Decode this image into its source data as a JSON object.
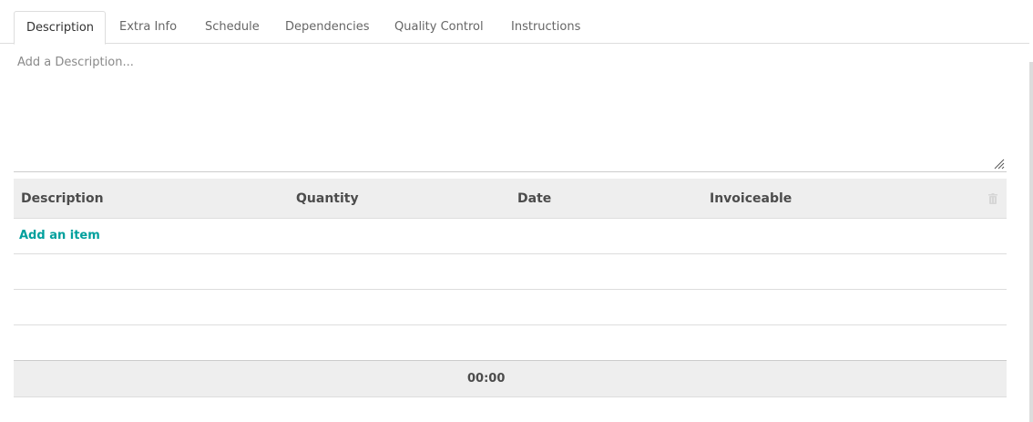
{
  "tabs": [
    {
      "label": "Description",
      "active": true
    },
    {
      "label": "Extra Info",
      "active": false
    },
    {
      "label": "Schedule",
      "active": false
    },
    {
      "label": "Dependencies",
      "active": false
    },
    {
      "label": "Quality Control",
      "active": false
    },
    {
      "label": "Instructions",
      "active": false
    }
  ],
  "description": {
    "placeholder": "Add a Description...",
    "value": ""
  },
  "table": {
    "columns": [
      "Description",
      "Quantity",
      "Date",
      "Invoiceable"
    ],
    "delete_icon": "trash-icon",
    "add_item_label": "Add an item",
    "rows": [],
    "total": "00:00"
  },
  "colors": {
    "accent": "#00a09d",
    "header_bg": "#eeeeee",
    "border": "#dddddd"
  }
}
